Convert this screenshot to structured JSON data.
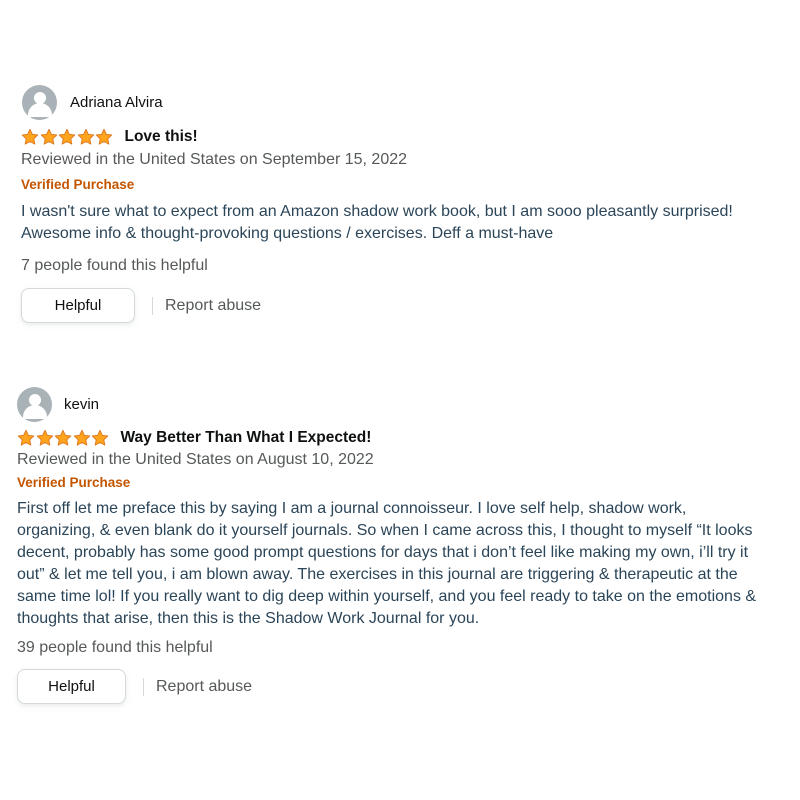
{
  "reviews": [
    {
      "reviewer": "Adriana Alvira",
      "rating": 5,
      "title": "Love this!",
      "date_line": "Reviewed in the United States on September 15, 2022",
      "verified": "Verified Purchase",
      "body": "I wasn't sure what to expect from an Amazon shadow work book, but I am sooo pleasantly surprised! Awesome info & thought-provoking questions / exercises. Deff a must-have",
      "helpful_count": "7 people found this helpful",
      "helpful_label": "Helpful",
      "report_label": "Report abuse"
    },
    {
      "reviewer": "kevin",
      "rating": 5,
      "title": "Way Better Than What I Expected!",
      "date_line": "Reviewed in the United States on August 10, 2022",
      "verified": "Verified Purchase",
      "body": "First off let me preface this by saying I am a journal connoisseur. I love self help, shadow work, organizing, & even blank do it yourself journals. So when I came across this, I thought to myself “It looks decent, probably has some good prompt questions for days that i don’t feel like making my own, i’ll try it out” & let me tell you, i am blown away. The exercises in this journal are triggering & therapeutic at the same time lol! If you really want to dig deep within yourself, and you feel ready to take on the emotions & thoughts that arise, then this is the Shadow Work Journal for you.",
      "helpful_count": "39 people found this helpful",
      "helpful_label": "Helpful",
      "report_label": "Report abuse"
    }
  ],
  "colors": {
    "star_fill": "#ffa41c",
    "star_stroke": "#de7921",
    "verified": "#c45500",
    "body_text": "#2b4558",
    "muted": "#565959"
  },
  "icons": {
    "avatar": "default-profile-icon",
    "star": "star-icon"
  }
}
